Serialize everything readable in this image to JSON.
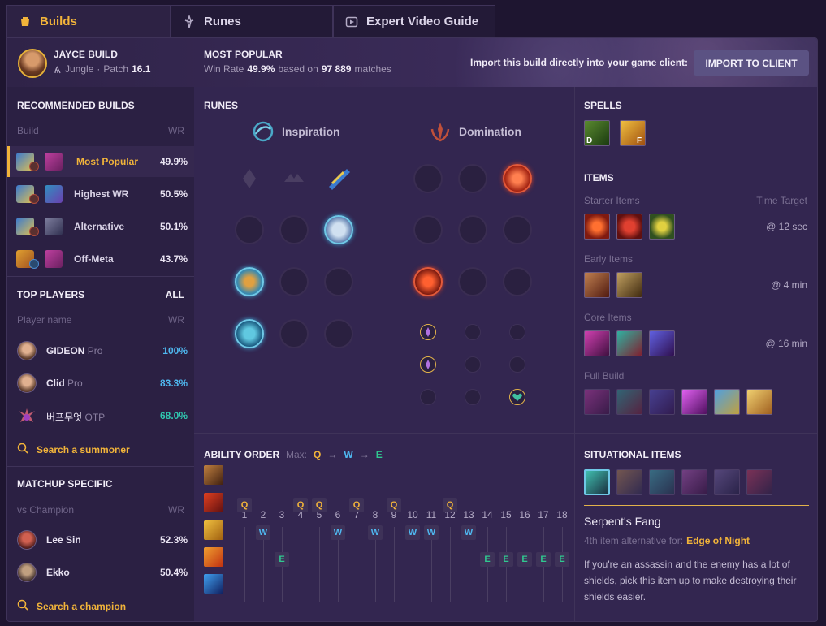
{
  "tabs": [
    {
      "label": "Builds",
      "icon": "builds-icon",
      "active": true
    },
    {
      "label": "Runes",
      "icon": "runes-icon",
      "active": false
    },
    {
      "label": "Expert Video Guide",
      "icon": "video-icon",
      "active": false
    }
  ],
  "header": {
    "title": "JAYCE BUILD",
    "role": "Jungle",
    "patch_label": "Patch",
    "patch": "16.1",
    "popular_title": "MOST POPULAR",
    "winrate_label": "Win Rate",
    "winrate": "49.9%",
    "based_on": "based on",
    "matches": "97 889",
    "matches_label": "matches",
    "import_text": "Import this build directly into your game client:",
    "import_button": "IMPORT TO CLIENT"
  },
  "recommended": {
    "title": "RECOMMENDED BUILDS",
    "col_build": "Build",
    "col_wr": "WR",
    "rows": [
      {
        "name": "Most Popular",
        "wr": "49.9%",
        "active": true
      },
      {
        "name": "Highest WR",
        "wr": "50.5%",
        "active": false
      },
      {
        "name": "Alternative",
        "wr": "50.1%",
        "active": false
      },
      {
        "name": "Off-Meta",
        "wr": "43.7%",
        "active": false
      }
    ]
  },
  "top_players": {
    "title": "TOP PLAYERS",
    "all": "ALL",
    "col_player": "Player name",
    "col_wr": "WR",
    "rows": [
      {
        "name": "GIDEON",
        "tag": "Pro",
        "wr": "100%",
        "color": "#4fb8f0"
      },
      {
        "name": "Clid",
        "tag": "Pro",
        "wr": "83.3%",
        "color": "#4fb8f0"
      },
      {
        "name": "버프무엇",
        "tag": "OTP",
        "wr": "68.0%",
        "color": "#30c8b0"
      }
    ],
    "search": "Search a summoner"
  },
  "matchup": {
    "title": "MATCHUP SPECIFIC",
    "col_champ": "vs Champion",
    "col_wr": "WR",
    "rows": [
      {
        "name": "Lee Sin",
        "wr": "52.3%"
      },
      {
        "name": "Ekko",
        "wr": "50.4%"
      }
    ],
    "search": "Search a champion"
  },
  "runes": {
    "title": "RUNES",
    "primary": "Inspiration",
    "secondary": "Domination"
  },
  "spells": {
    "title": "SPELLS",
    "keys": [
      "D",
      "F"
    ]
  },
  "items": {
    "title": "ITEMS",
    "starter_label": "Starter Items",
    "time_target": "Time Target",
    "starter_time": "@ 12 sec",
    "early_label": "Early Items",
    "early_time": "@ 4 min",
    "core_label": "Core Items",
    "core_time": "@ 16 min",
    "full_label": "Full Build"
  },
  "ability_order": {
    "title": "ABILITY ORDER",
    "max_label": "Max:",
    "max_seq": [
      "Q",
      "W",
      "E"
    ],
    "levels": [
      "1",
      "2",
      "3",
      "4",
      "5",
      "6",
      "7",
      "8",
      "9",
      "10",
      "11",
      "12",
      "13",
      "14",
      "15",
      "16",
      "17",
      "18"
    ],
    "q_levels": [
      1,
      4,
      5,
      7,
      9,
      12
    ],
    "w_levels": [
      2,
      6,
      8,
      10,
      11,
      13
    ],
    "e_levels": [
      3,
      14,
      15,
      16,
      17,
      18
    ]
  },
  "situational": {
    "title": "SITUATIONAL ITEMS",
    "item_name": "Serpent's Fang",
    "alt_label": "4th item alternative for:",
    "alt_item": "Edge of Night",
    "description": "If you're an assassin and the enemy has a lot of shields, pick this item up to make destroying their shields easier."
  },
  "colors": {
    "accent": "#f2b43a",
    "q": "#f2b43a",
    "w": "#4fb8f0",
    "e": "#30c890",
    "background": "#1e1530",
    "panel": "#332650"
  }
}
